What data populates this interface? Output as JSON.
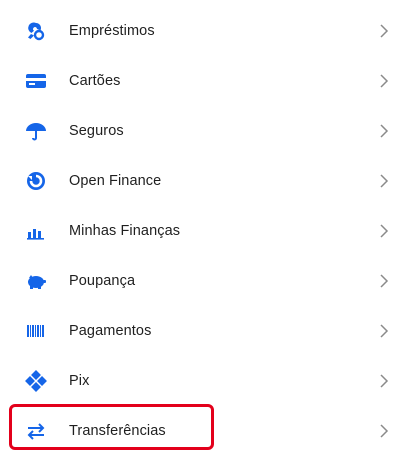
{
  "menu": {
    "items": [
      {
        "label": "Empréstimos",
        "icon": "loan-icon"
      },
      {
        "label": "Cartões",
        "icon": "card-icon"
      },
      {
        "label": "Seguros",
        "icon": "umbrella-icon"
      },
      {
        "label": "Open Finance",
        "icon": "open-finance-icon"
      },
      {
        "label": "Minhas Finanças",
        "icon": "bar-chart-icon"
      },
      {
        "label": "Poupança",
        "icon": "piggy-bank-icon"
      },
      {
        "label": "Pagamentos",
        "icon": "barcode-icon"
      },
      {
        "label": "Pix",
        "icon": "pix-icon"
      },
      {
        "label": "Transferências",
        "icon": "transfer-arrows-icon"
      }
    ],
    "highlighted_item": "Transferências"
  },
  "colors": {
    "icon_blue": "#1565e8",
    "text": "#1f1f1f",
    "chevron": "#8a8a8a",
    "highlight_border": "#e3001b"
  }
}
